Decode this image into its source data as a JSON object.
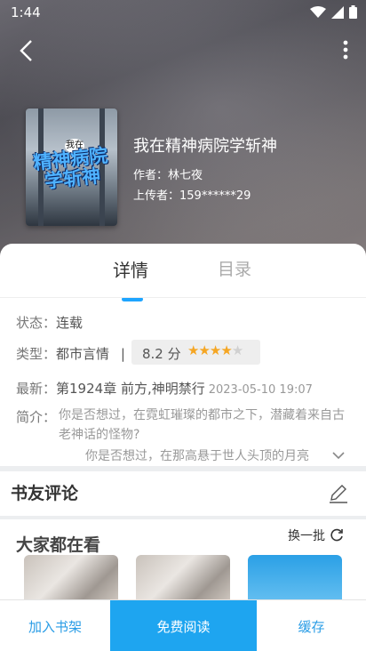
{
  "status_bar": {
    "time": "1:44"
  },
  "book": {
    "title": "我在精神病院学斩神",
    "author": "作者：林七夜",
    "uploader": "上传者：159******29",
    "cover_tag": "我在",
    "cover_title": "精神病院学斩神"
  },
  "tabs": {
    "details": "详情",
    "catalog": "目录"
  },
  "details": {
    "status_label": "状态：",
    "status_value": "连载",
    "type_label": "类型：",
    "type_value": "都市言情",
    "type_sep": "|",
    "score": "8.2 分",
    "stars_filled": 4,
    "stars_total": 5,
    "latest_label": "最新：",
    "latest_value": "第1924章 前方,神明禁行",
    "latest_date": "2023-05-10 19:07",
    "intro_label": "简介：",
    "intro_text": "你是否想过，在霓虹璀璨的都市之下，潜藏着来自古老神话的怪物?",
    "intro_text_2": "你是否想过，在那高悬于世人头顶的月亮"
  },
  "comments": {
    "title": "书友评论"
  },
  "recommend": {
    "title": "大家都在看",
    "refresh_label": "换一批"
  },
  "bottom_bar": {
    "add_shelf": "加入书架",
    "read_free": "免费阅读",
    "cache": "缓存"
  },
  "colors": {
    "accent": "#1ea5f0",
    "star": "#f5a623"
  }
}
